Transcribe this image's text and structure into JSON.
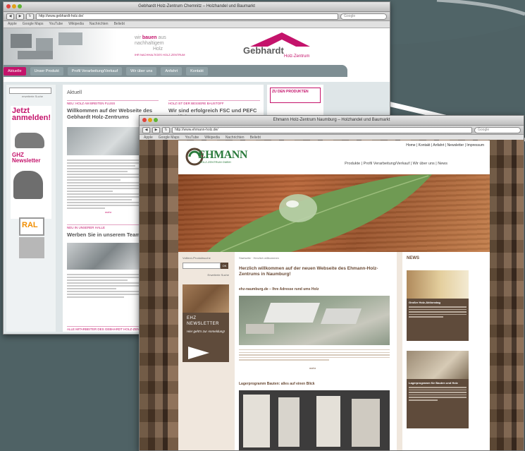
{
  "back_window": {
    "title": "Gebhardt Holz-Zentrum Chemnitz – Holzhandel und Baumarkt",
    "url": "http://www.gebhardt-holz.de/",
    "search_placeholder": "Google",
    "bookmarks": [
      "Apple",
      "Google Maps",
      "YouTube",
      "Wikipedia",
      "Nachrichten",
      "Beliebt"
    ],
    "slogan_line1": "wir ",
    "slogan_bold": "bauen",
    "slogan_line1_end": " aus",
    "slogan_line2": "  nachhaltigem",
    "slogan_line3": "Holz",
    "slogan_small": "IHR NACHHALTIGES HOLZ-ZENTRUM",
    "logo_text": "Gebhardt",
    "logo_sub": "Holz-Zentrum",
    "nav": [
      "Aktuelle",
      "Unser Produkt",
      "Profil Verarbeitung/Verkauf",
      "Wir über uns",
      "Anfahrt",
      "Kontakt"
    ],
    "search_link": "erweiterte Suche",
    "promo_title": "Jetzt anmelden!",
    "promo_news": "GHZ Newsletter",
    "ral_label": "RAL",
    "main_title": "Aktuell",
    "pink_label_1": "NEU: HOLZ AM BREITEN FLUSS",
    "pink_label_2": "HOLZ IST DER BESSERE BAUSTOFF",
    "headline_1": "Willkommen auf der Webseite des Gebhardt Holz-Zentrums",
    "headline_2": "Wir sind erfolgreich FSC und PEFC zertifiziert",
    "pink_label_3": "NEU IN UNSERER HALLE",
    "headline_3": "Werben Sie in unserem Team",
    "more_link": "mehr",
    "right_header": "ZU DEN PRODUKTEN",
    "footer_label": "ALLE MITARBEITER DES GEBHARDT HOLZ-ZENTRUMS"
  },
  "front_window": {
    "title": "Ehmann Holz-Zentrum Naumburg – Holzhandel und Baumarkt",
    "url": "http://www.ehmann-holz.de/",
    "search_placeholder": "Google",
    "bookmarks": [
      "Apple",
      "Google Maps",
      "YouTube",
      "Wikipedia",
      "Nachrichten",
      "Beliebt"
    ],
    "utility_links": "Home  |  Kontakt  |  Anfahrt  |  Newsletter  |  Impressum",
    "logo_text": "EHMANN",
    "logo_sub": "HOLZ-ZENTRUM GMBH",
    "nav": "Produkte  |  Profil Verarbeitung/Verkauf  |  Wir über uns  |  News",
    "search_label": "Volltext-/Produktsuche",
    "search_button": "OK",
    "search_link": "Erweiterte Suche",
    "newsletter_title": "EHZ NEWSLETTER",
    "newsletter_cta": "Hier geht's zur Anmeldung!",
    "breadcrumb": "Startseite · Herzlich willkommen",
    "headline": "Herzlich willkommen auf der neuen Webseite des Ehmann-Holz-Zentrums in Naumburg!",
    "section_1": "ehz-naumburg.de – Ihre Adresse rund ums Holz",
    "section_2": "Lagerprogramm Bauten: alles auf einen Blick",
    "more_link": "mehr",
    "news_header": "NEWS",
    "news_1_title": "Großer Holz-Aktionstag",
    "news_2_title": "Lagerprogramm für Bauten und Holz"
  },
  "colors": {
    "background": "#4f6265",
    "gebhardt_magenta": "#c4136b",
    "ehmann_green": "#2a7a3b",
    "ehmann_brown": "#5f4b3b"
  },
  "icons": [
    "back-arrow-icon",
    "forward-arrow-icon",
    "reload-icon",
    "search-icon",
    "leaf-waterdrop-image",
    "ehmann-logo-icon",
    "gebhardt-roof-logo-icon"
  ]
}
